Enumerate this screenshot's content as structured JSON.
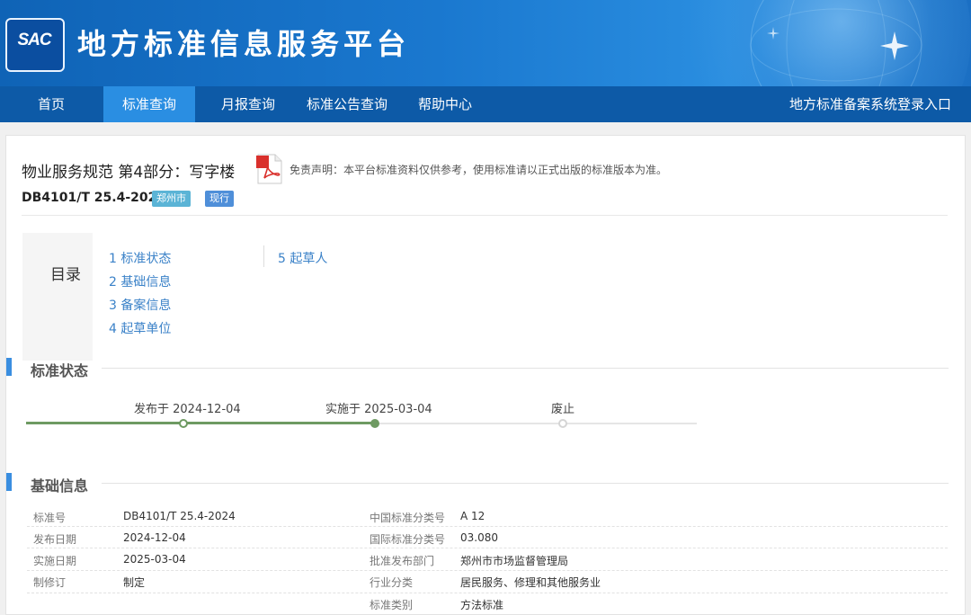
{
  "header": {
    "logo_text": "SAC",
    "site_title": "地方标准信息服务平台"
  },
  "nav": {
    "items": [
      "首页",
      "标准查询",
      "月报查询",
      "标准公告查询",
      "帮助中心"
    ],
    "active_index": 1,
    "login_link": "地方标准备案系统登录入口"
  },
  "standard": {
    "title": "物业服务规范 第4部分：写字楼",
    "disclaimer": "免责声明：本平台标准资料仅供参考，使用标准请以正式出版的标准版本为准。",
    "number": "DB4101/T 25.4-2024",
    "badge_city": "郑州市",
    "badge_status": "现行"
  },
  "toc": {
    "label": "目录",
    "items": [
      "1 标准状态",
      "2 基础信息",
      "3 备案信息",
      "4 起草单位",
      "5 起草人"
    ]
  },
  "status_section": {
    "title": "标准状态",
    "steps": [
      "发布于 2024-12-04",
      "实施于 2025-03-04",
      "废止"
    ]
  },
  "basic_section": {
    "title": "基础信息",
    "rows": [
      {
        "k1": "标准号",
        "v1": "DB4101/T 25.4-2024",
        "k2": "中国标准分类号",
        "v2": "A 12"
      },
      {
        "k1": "发布日期",
        "v1": "2024-12-04",
        "k2": "国际标准分类号",
        "v2": "03.080"
      },
      {
        "k1": "实施日期",
        "v1": "2025-03-04",
        "k2": "批准发布部门",
        "v2": "郑州市市场监督管理局"
      },
      {
        "k1": "制修订",
        "v1": "制定",
        "k2": "行业分类",
        "v2": "居民服务、修理和其他服务业"
      },
      {
        "k1": "",
        "v1": "",
        "k2": "标准类别",
        "v2": "方法标准"
      }
    ]
  },
  "colors": {
    "banner": "#1a78cf",
    "nav": "#0d5aa7",
    "nav_active": "#2a8ee2",
    "accent": "#3a8ee0",
    "timeline_done": "#6e9a62"
  }
}
